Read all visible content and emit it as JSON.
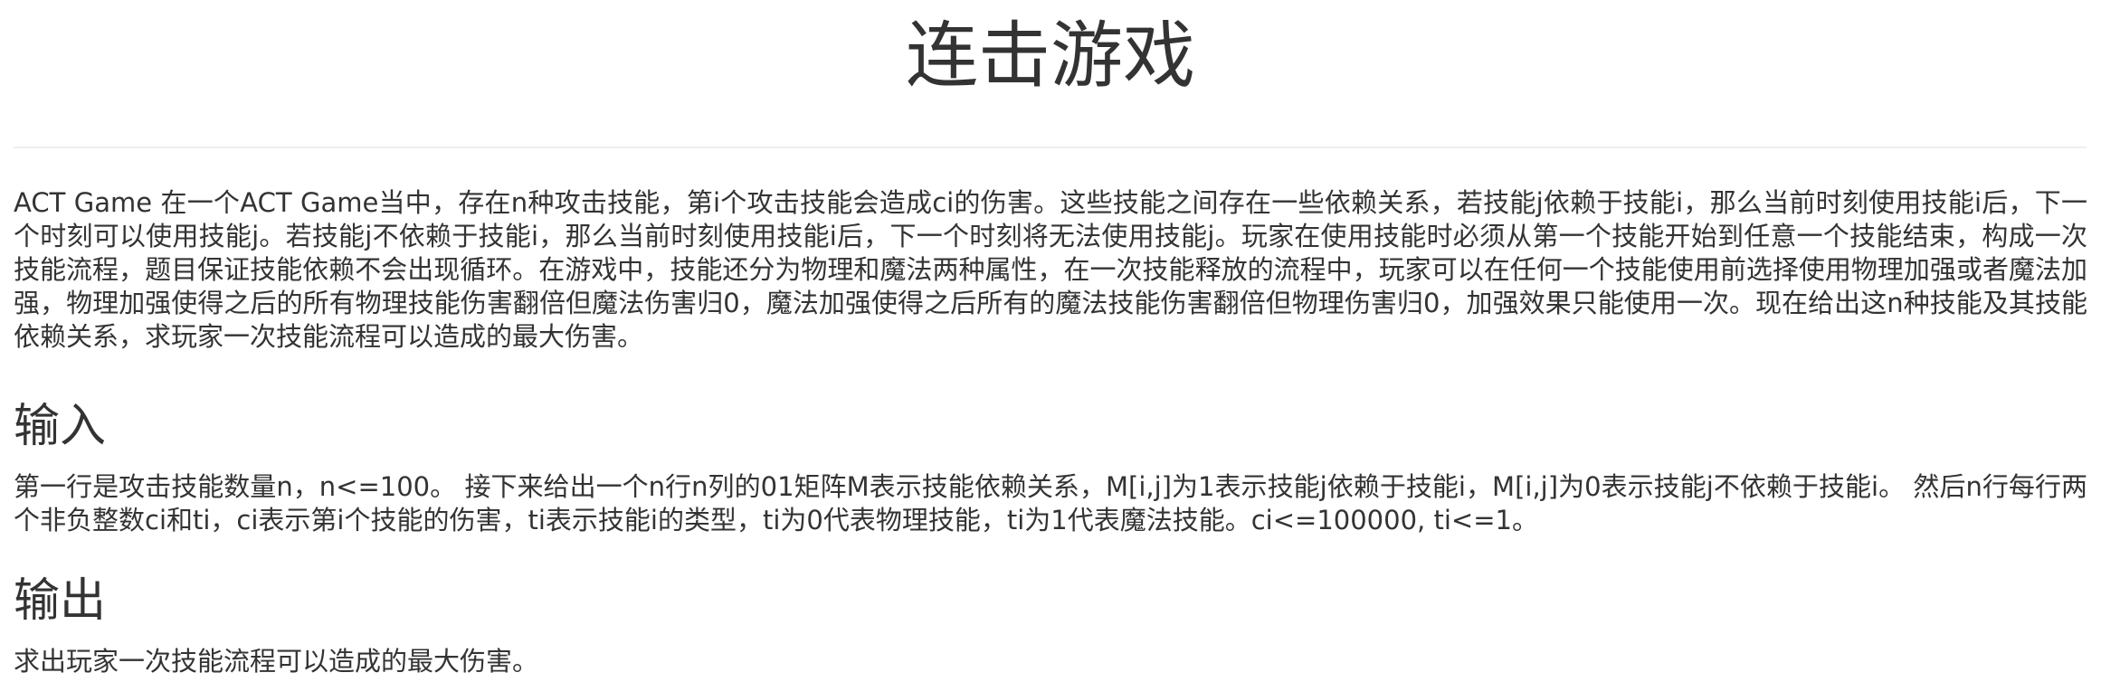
{
  "problem": {
    "title": "连击游戏",
    "description": "ACT Game 在一个ACT Game当中，存在n种攻击技能，第i个攻击技能会造成ci的伤害。这些技能之间存在一些依赖关系，若技能j依赖于技能i，那么当前时刻使用技能i后，下一个时刻可以使用技能j。若技能j不依赖于技能i，那么当前时刻使用技能i后，下一个时刻将无法使用技能j。玩家在使用技能时必须从第一个技能开始到任意一个技能结束，构成一次技能流程，题目保证技能依赖不会出现循环。在游戏中，技能还分为物理和魔法两种属性，在一次技能释放的流程中，玩家可以在任何一个技能使用前选择使用物理加强或者魔法加强，物理加强使得之后的所有物理技能伤害翻倍但魔法伤害归0，魔法加强使得之后所有的魔法技能伤害翻倍但物理伤害归0，加强效果只能使用一次。现在给出这n种技能及其技能依赖关系，求玩家一次技能流程可以造成的最大伤害。",
    "input_heading": "输入",
    "input_text": "第一行是攻击技能数量n，n<=100。 接下来给出一个n行n列的01矩阵M表示技能依赖关系，M[i,j]为1表示技能j依赖于技能i，M[i,j]为0表示技能j不依赖于技能i。 然后n行每行两个非负整数ci和ti，ci表示第i个技能的伤害，ti表示技能i的类型，ti为0代表物理技能，ti为1代表魔法技能。ci<=100000, ti<=1。",
    "output_heading": "输出",
    "output_text": "求出玩家一次技能流程可以造成的最大伤害。"
  },
  "colors": {
    "text": "#333333",
    "divider": "#eeeeee",
    "background": "#ffffff"
  }
}
